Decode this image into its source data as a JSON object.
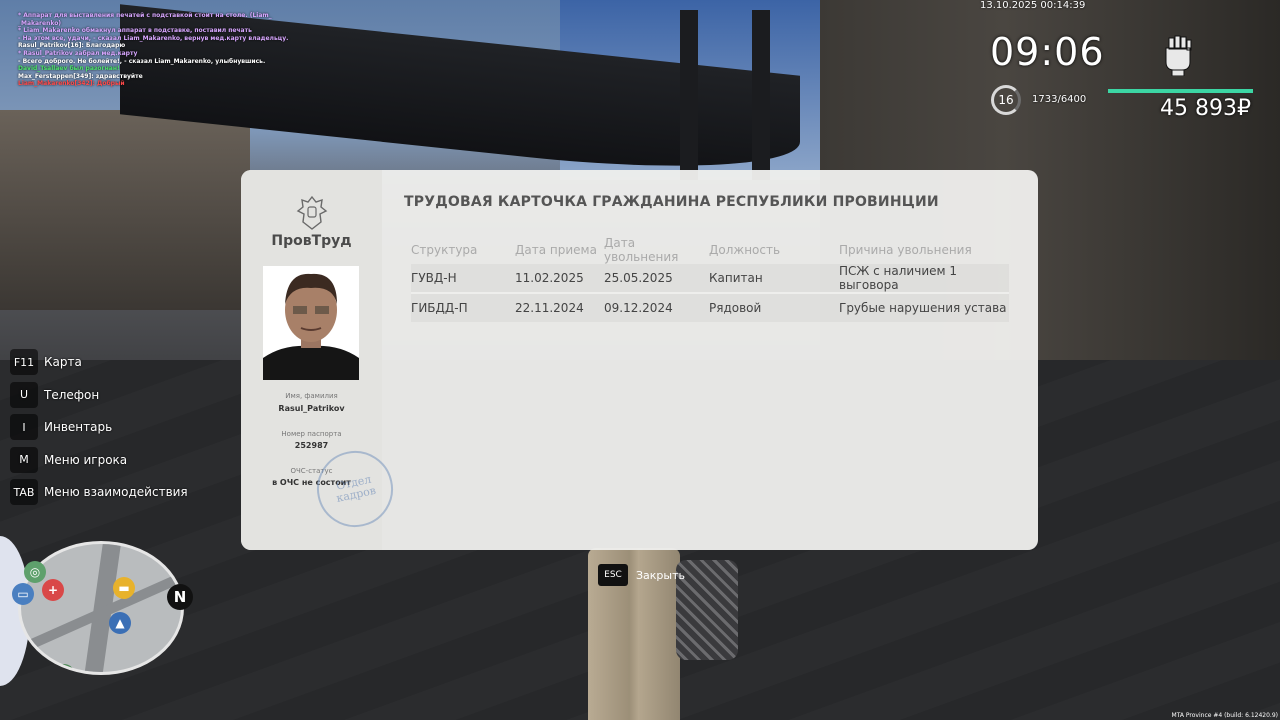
{
  "chat": [
    {
      "text": "* Аппарат для выставления печатей с подставкой стоит на столе. (Liam_",
      "color": "#d8a6ff"
    },
    {
      "text": "_Makarenko)",
      "color": "#d8a6ff"
    },
    {
      "text": "* Liam_Makarenko обмакнул аппарат в подставке, поставил печать",
      "color": "#d8a6ff"
    },
    {
      "text": "- На этом все, удачи, - сказал Liam_Makarenko, вернув мед.карту владельцу.",
      "color": "#d8a6ff"
    },
    {
      "text": "Rasul_Patrikov[16]: Благодарю",
      "color": "#ffffff"
    },
    {
      "text": "* Rasul_Patrikov забрал мед.карту",
      "color": "#d8a6ff"
    },
    {
      "text": "- Всего доброго. Не болейте!, - сказал Liam_Makarenko, улыбнувшись.",
      "color": "#ffffff"
    },
    {
      "text": "David_Tsallaev был разогнан!",
      "color": "#4be36a"
    },
    {
      "text": "Max_Ferstappen[349]: здравствуйте",
      "color": "#ffffff"
    },
    {
      "text": "Liam_Makarenko[342]: Добрый",
      "color": "#ff4a4a"
    }
  ],
  "hud": {
    "datetime": "13.10.2025 00:14:39",
    "clock": "09:06",
    "level": "16",
    "xp": "1733/6400",
    "money": "45 893₽",
    "health_fraction": 1.0,
    "health_color": "#3cd6a4"
  },
  "binds": [
    {
      "key": "F11",
      "label": "Карта"
    },
    {
      "key": "U",
      "label": "Телефон"
    },
    {
      "key": "I",
      "label": "Инвентарь"
    },
    {
      "key": "M",
      "label": "Меню игрока"
    },
    {
      "key": "TAB",
      "label": "Меню взаимодействия"
    }
  ],
  "minimap": {
    "north": "N"
  },
  "card": {
    "org": "ПровТруд",
    "title": "ТРУДОВАЯ КАРТОЧКА ГРАЖДАНИНА РЕСПУБЛИКИ ПРОВИНЦИИ",
    "name_label": "Имя, фамилия",
    "name": "Rasul_Patrikov",
    "passport_label": "Номер паспорта",
    "passport": "252987",
    "ocs_label": "ОЧС-статус",
    "ocs": "в ОЧС не состоит",
    "stamp_line1": "Отдел",
    "stamp_line2": "кадров",
    "columns": [
      "Структура",
      "Дата приема",
      "Дата увольнения",
      "Должность",
      "Причина увольнения"
    ],
    "rows": [
      [
        "ГУВД-Н",
        "11.02.2025",
        "25.05.2025",
        "Капитан",
        "ПСЖ с наличием 1 выговора"
      ],
      [
        "ГИБДД-П",
        "22.11.2024",
        "09.12.2024",
        "Рядовой",
        "Грубые нарушения устава"
      ]
    ]
  },
  "close": {
    "key": "ESC",
    "label": "Закрыть"
  },
  "build": "MTA Province #4 (build: 6.12420.9)"
}
